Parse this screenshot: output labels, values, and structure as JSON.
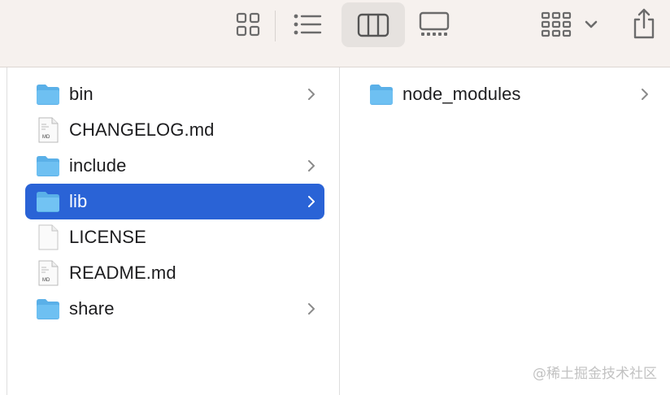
{
  "toolbar": {
    "icons": [
      "icon-view-grid-icon",
      "list-view-icon",
      "column-view-icon",
      "gallery-view-icon",
      "group-by-icon",
      "chevron-down-icon",
      "share-icon"
    ],
    "active_view": "columns"
  },
  "column1": {
    "items": [
      {
        "label": "bin",
        "type": "folder",
        "has_children": true
      },
      {
        "label": "CHANGELOG.md",
        "type": "md",
        "has_children": false
      },
      {
        "label": "include",
        "type": "folder",
        "has_children": true
      },
      {
        "label": "lib",
        "type": "folder",
        "has_children": true,
        "selected": true
      },
      {
        "label": "LICENSE",
        "type": "file",
        "has_children": false
      },
      {
        "label": "README.md",
        "type": "md",
        "has_children": false
      },
      {
        "label": "share",
        "type": "folder",
        "has_children": true
      }
    ]
  },
  "column2": {
    "items": [
      {
        "label": "node_modules",
        "type": "folder",
        "has_children": true
      }
    ]
  },
  "watermark": "@稀土掘金技术社区",
  "colors": {
    "selection": "#2a63d6",
    "folder": "#5ab0e8",
    "toolbar_bg": "#f6f1ee"
  }
}
